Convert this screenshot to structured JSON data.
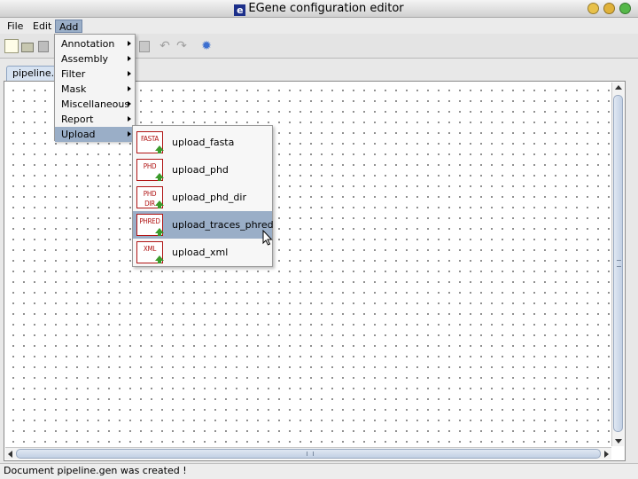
{
  "window": {
    "title": "EGene configuration editor",
    "logo_letter": "e",
    "controls": [
      {
        "name": "close",
        "color": "#e8c14a"
      },
      {
        "name": "minimize",
        "color": "#e0b23a"
      },
      {
        "name": "maximize",
        "color": "#55b849"
      }
    ]
  },
  "menubar": {
    "items": [
      "File",
      "Edit",
      "Add"
    ],
    "active": "Add"
  },
  "toolbar": {
    "icons": [
      "new-document-icon",
      "open-folder-icon",
      "paste-icon",
      "paste-disabled-icon",
      "undo-icon",
      "redo-icon",
      "settings-icon"
    ],
    "undo_glyph": "↶",
    "redo_glyph": "↷",
    "settings_glyph": "✹"
  },
  "tabs": [
    {
      "label": "pipeline.gen",
      "active": true
    }
  ],
  "add_menu": {
    "items": [
      {
        "label": "Annotation",
        "has_submenu": true
      },
      {
        "label": "Assembly",
        "has_submenu": true
      },
      {
        "label": "Filter",
        "has_submenu": true
      },
      {
        "label": "Mask",
        "has_submenu": true
      },
      {
        "label": "Miscellaneous",
        "has_submenu": true
      },
      {
        "label": "Report",
        "has_submenu": true
      },
      {
        "label": "Upload",
        "has_submenu": true,
        "selected": true
      }
    ]
  },
  "upload_menu": {
    "items": [
      {
        "label": "upload_fasta",
        "icon_text": "FASTA",
        "icon": "fasta-upload-icon"
      },
      {
        "label": "upload_phd",
        "icon_text": "PHD",
        "icon": "phd-upload-icon"
      },
      {
        "label": "upload_phd_dir",
        "icon_text": "PHD DIR",
        "icon": "phd-dir-upload-icon"
      },
      {
        "label": "upload_traces_phred",
        "icon_text": "PHRED",
        "icon": "phred-upload-icon",
        "selected": true
      },
      {
        "label": "upload_xml",
        "icon_text": "XML",
        "icon": "xml-upload-icon"
      }
    ]
  },
  "status": {
    "message": "Document pipeline.gen was created !"
  },
  "colors": {
    "selection": "#9aaec7",
    "icon_border": "#b01414",
    "upload_arrow": "#3a9a2a"
  }
}
